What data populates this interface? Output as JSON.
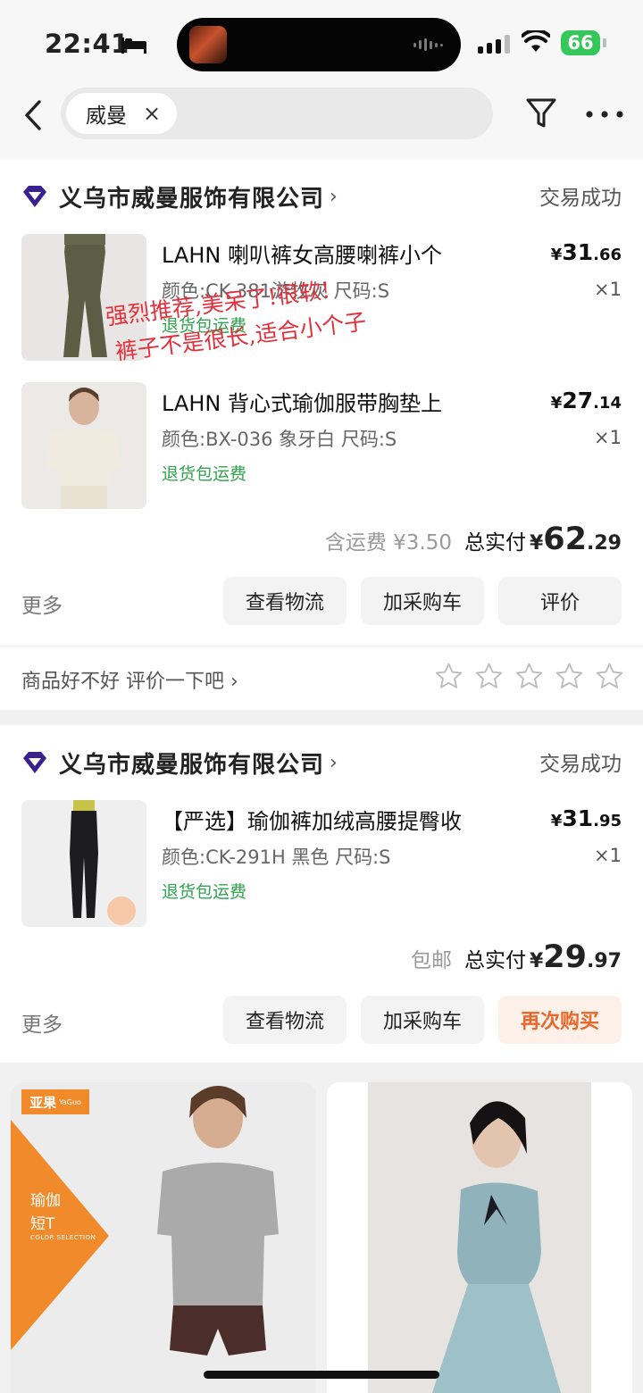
{
  "status_bar": {
    "time": "22:41",
    "battery": "66"
  },
  "search": {
    "chip_text": "威曼",
    "clear_icon": "×"
  },
  "orders": [
    {
      "store": "义乌市威曼服饰有限公司",
      "status": "交易成功",
      "items": [
        {
          "title": "LAHN 喇叭裤女高腰喇裤小个",
          "spec": "颜色:CK-381游牧灰 尺码:S",
          "tag": "退货包运费",
          "price_symbol": "¥",
          "price_int": "31",
          "price_dec": ".66",
          "qty": "×1"
        },
        {
          "title": "LAHN 背心式瑜伽服带胸垫上",
          "spec": "颜色:BX-036 象牙白 尺码:S",
          "tag": "退货包运费",
          "price_symbol": "¥",
          "price_int": "27",
          "price_dec": ".14",
          "qty": "×1"
        }
      ],
      "shipping_note": "含运费 ¥3.50",
      "paid_label": "总实付",
      "total_symbol": "¥",
      "total_int": "62",
      "total_dec": ".29",
      "more": "更多",
      "buttons": [
        "查看物流",
        "加采购车",
        "评价"
      ],
      "review_prompt": "商品好不好 评价一下吧 ›"
    },
    {
      "store": "义乌市威曼服饰有限公司",
      "status": "交易成功",
      "items": [
        {
          "title": "【严选】瑜伽裤加绒高腰提臀收",
          "spec": "颜色:CK-291H 黑色 尺码:S",
          "tag": "退货包运费",
          "price_symbol": "¥",
          "price_int": "31",
          "price_dec": ".95",
          "qty": "×1"
        }
      ],
      "shipping_note": "包邮",
      "paid_label": "总实付",
      "total_symbol": "¥",
      "total_int": "29",
      "total_dec": ".97",
      "more": "更多",
      "buttons": [
        "查看物流",
        "加采购车",
        "再次购买"
      ]
    }
  ],
  "annotation": {
    "line1": "强烈推荐,美呆了!很软!",
    "line2": "裤子不是很长,适合小个子"
  },
  "recommendations": [
    {
      "brand": "亚果",
      "brand_en": "YaGuo",
      "title_line1": "瑜伽",
      "title_line2": "短T",
      "sub": "COLOR SELECTION"
    },
    {}
  ],
  "icons": {
    "sleep": "bed-icon",
    "wifi": "wifi-icon",
    "back": "chevron-left-icon",
    "filter": "funnel-icon",
    "more": "ellipsis-icon",
    "store": "diamond-icon",
    "star": "star-outline-icon"
  },
  "colors": {
    "accent": "#e9672a",
    "green_tag": "#2fa44e",
    "annotation": "#e4303b",
    "battery": "#35c759"
  }
}
